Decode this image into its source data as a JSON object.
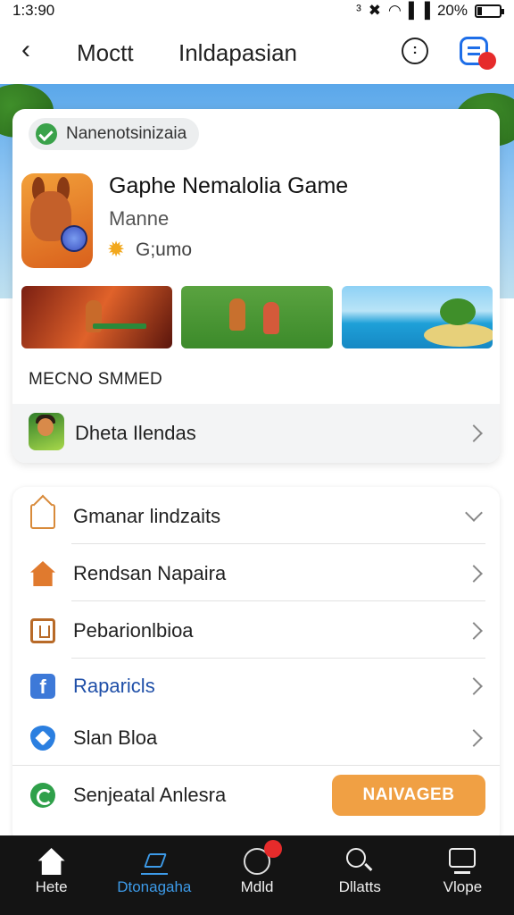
{
  "status_bar": {
    "time": "1:3:90",
    "icons": [
      "bluetooth-icon",
      "close-icon",
      "wifi-icon",
      "signal-icon"
    ],
    "battery": "20%",
    "battery_level": 0.2
  },
  "top_bar": {
    "title": "Moctt",
    "subtitle": "Inldapasian"
  },
  "app": {
    "badge": "Nanenotsinizaia",
    "title": "Gaphe Nemalolia Game",
    "developer": "Manne",
    "rating_text": "G;umo"
  },
  "section": {
    "title": "MECNO SMMED"
  },
  "tips": {
    "label": "Dheta Ilendas"
  },
  "list": [
    {
      "label": "Gmanar lindzaits",
      "icon": "home-outline-icon"
    },
    {
      "label": "Rendsan Napaira",
      "icon": "house-icon"
    },
    {
      "label": "Pebarionlbioa",
      "icon": "square-icon"
    },
    {
      "label": "Raparicls",
      "icon": "facebook-icon"
    },
    {
      "label": "Slan Bloa",
      "icon": "shield-icon"
    },
    {
      "label": "Senjeatal Anlesra",
      "icon": "refresh-icon"
    }
  ],
  "cta": {
    "label": "NAIVAGEB"
  },
  "bottom_nav": [
    {
      "label": "Hete",
      "icon": "home-icon",
      "active": false
    },
    {
      "label": "Dtonagaha",
      "icon": "sparkle-icon",
      "active": true
    },
    {
      "label": "Mdld",
      "icon": "circle-icon",
      "active": false
    },
    {
      "label": "Dllatts",
      "icon": "search-icon",
      "active": false
    },
    {
      "label": "Vlope",
      "icon": "screen-icon",
      "active": false
    }
  ],
  "colors": {
    "accent": "#3d9be9",
    "cta": "#f0a044",
    "badge": "#e62b2b"
  }
}
